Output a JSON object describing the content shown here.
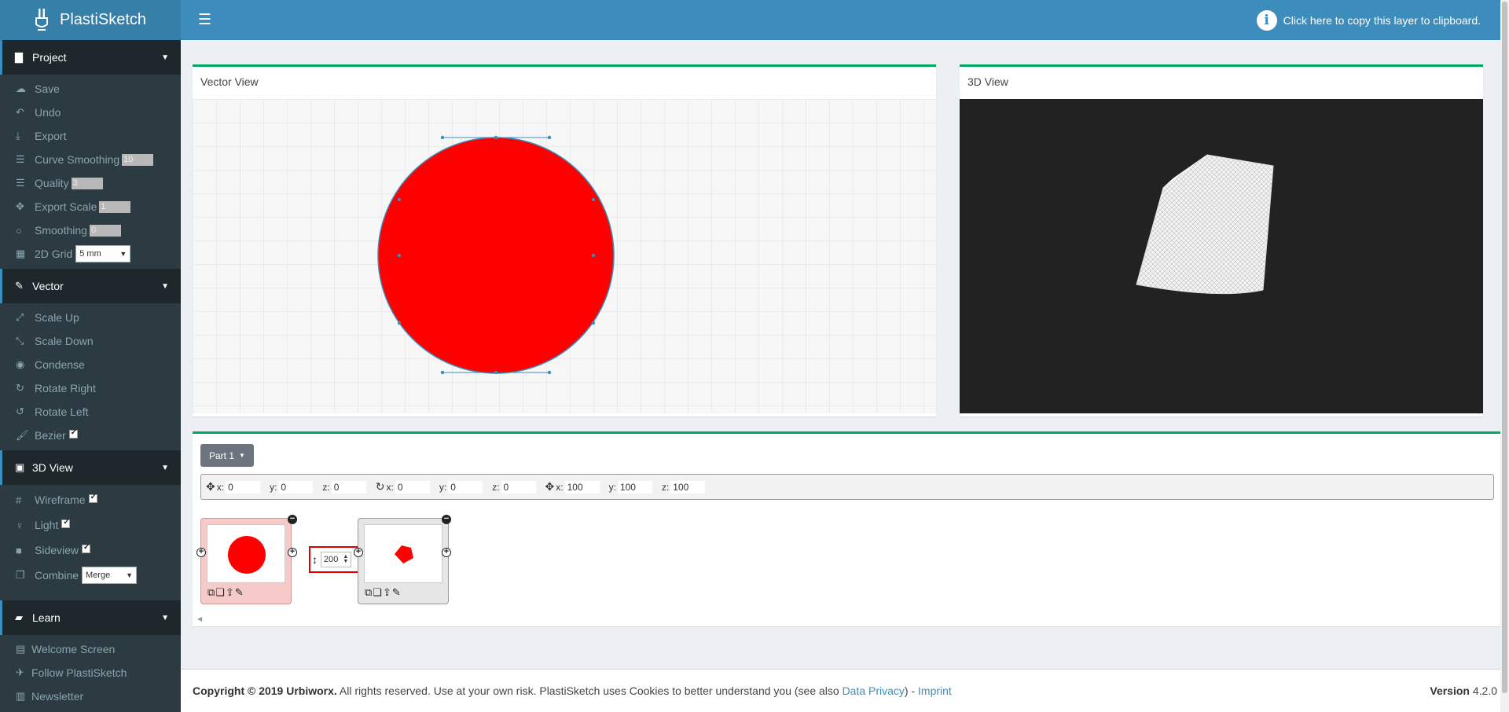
{
  "app": {
    "title": "PlastiSketch"
  },
  "header": {
    "copy_layer_text": "Click here to copy this layer to clipboard."
  },
  "sidebar": {
    "project": {
      "title": "Project",
      "items": {
        "save": "Save",
        "undo": "Undo",
        "export": "Export",
        "curve_smoothing": "Curve Smoothing",
        "curve_smoothing_value": "10",
        "quality": "Quality",
        "quality_value": "3",
        "export_scale": "Export Scale",
        "export_scale_value": "1",
        "smoothing": "Smoothing",
        "smoothing_value": "0",
        "grid_2d": "2D Grid",
        "grid_2d_value": "5 mm"
      }
    },
    "vector": {
      "title": "Vector",
      "items": {
        "scale_up": "Scale Up",
        "scale_down": "Scale Down",
        "condense": "Condense",
        "rotate_right": "Rotate Right",
        "rotate_left": "Rotate Left",
        "bezier": "Bezier"
      }
    },
    "view3d": {
      "title": "3D View",
      "items": {
        "wireframe": "Wireframe",
        "light": "Light",
        "sideview": "Sideview",
        "combine": "Combine",
        "combine_value": "Merge"
      }
    },
    "learn": {
      "title": "Learn",
      "items": {
        "welcome": "Welcome Screen",
        "follow": "Follow PlastiSketch",
        "newsletter": "Newsletter"
      }
    }
  },
  "panels": {
    "vector_view_title": "Vector View",
    "view3d_title": "3D View",
    "shape_color": "#ff0000",
    "wire_color": "#ffffff"
  },
  "parts": {
    "part_label": "Part 1",
    "transform": {
      "pos_x_label": "x:",
      "pos_x": "0",
      "pos_y_label": "y:",
      "pos_y": "0",
      "pos_z_label": "z:",
      "pos_z": "0",
      "rot_x_label": "x:",
      "rot_x": "0",
      "rot_y_label": "y:",
      "rot_y": "0",
      "rot_z_label": "z:",
      "rot_z": "0",
      "scale_x_label": "x:",
      "scale_x": "100",
      "scale_y_label": "y:",
      "scale_y": "100",
      "scale_z_label": "z:",
      "scale_z": "100"
    },
    "layer_height": "200"
  },
  "footer": {
    "copyright": "Copyright © 2019 Urbiworx.",
    "notice": " All rights reserved. Use at your own risk. PlastiSketch uses Cookies to better understand you (see also ",
    "privacy_link": "Data Privacy",
    "separator": ") - ",
    "imprint_link": "Imprint",
    "version_label": "Version",
    "version": "4.2.0"
  },
  "colors": {
    "header_bg": "#3c8dbc",
    "logo_bg": "#367fa9",
    "sidebar_bg": "#2c3b41",
    "accent_green": "#00a65a"
  }
}
